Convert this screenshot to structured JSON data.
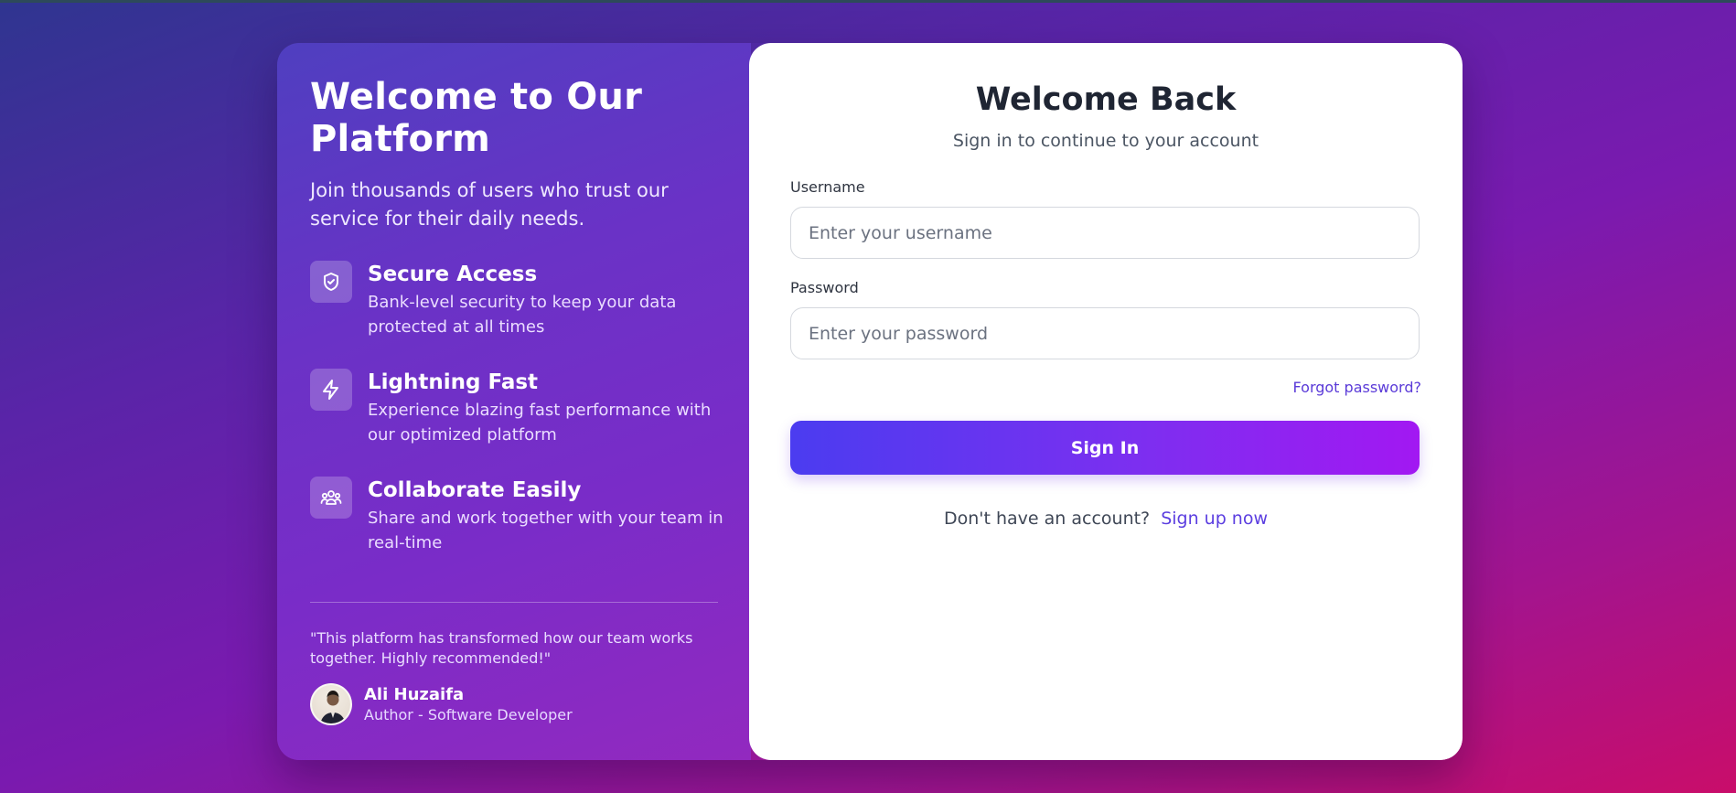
{
  "left": {
    "title": "Welcome to Our Platform",
    "intro": "Join thousands of users who trust our service for their daily needs.",
    "features": [
      {
        "icon": "shield-check-icon",
        "title": "Secure Access",
        "description": "Bank-level security to keep your data protected at all times"
      },
      {
        "icon": "lightning-icon",
        "title": "Lightning Fast",
        "description": "Experience blazing fast performance with our optimized platform"
      },
      {
        "icon": "users-icon",
        "title": "Collaborate Easily",
        "description": "Share and work together with your team in real-time"
      }
    ],
    "quote": "\"This platform has transformed how our team works together. Highly recommended!\"",
    "author": {
      "name": "Ali Huzaifa",
      "role": "Author - Software Developer"
    }
  },
  "form": {
    "title": "Welcome Back",
    "subtitle": "Sign in to continue to your account",
    "username_label": "Username",
    "username_placeholder": "Enter your username",
    "username_value": "",
    "password_label": "Password",
    "password_placeholder": "Enter your password",
    "password_value": "",
    "forgot_link": "Forgot password?",
    "submit_label": "Sign In",
    "signup_prompt": "Don't have an account?",
    "signup_link": "Sign up now"
  },
  "colors": {
    "accent": "#5b3ee0",
    "button_gradient_start": "#4b3cf0",
    "button_gradient_end": "#a218f2",
    "background_start": "#2f3590",
    "background_end": "#c90d6a"
  }
}
